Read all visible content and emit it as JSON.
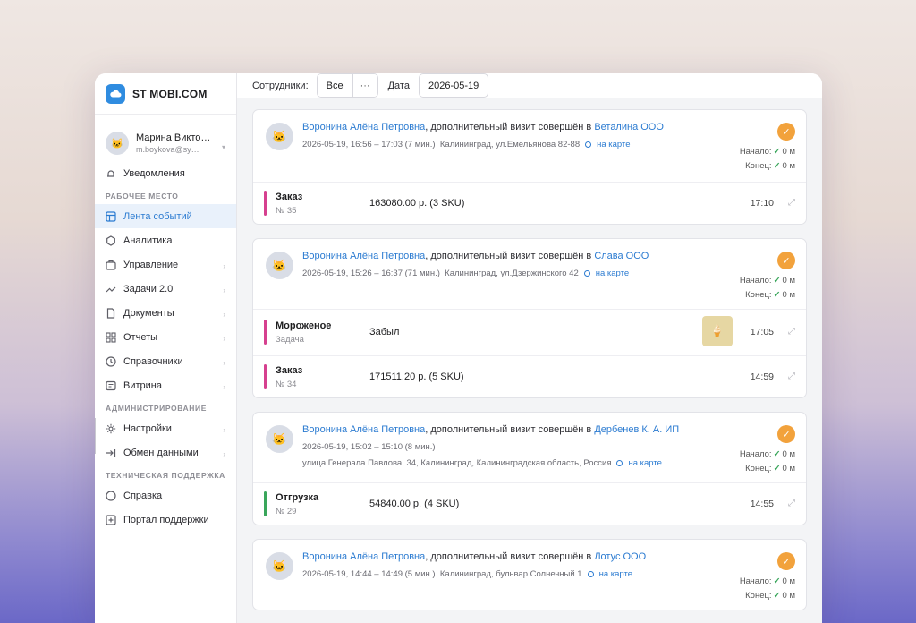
{
  "brand": {
    "name": "ST MOBI.COM",
    "icon": "cloud-icon"
  },
  "user": {
    "name": "Марина Викто…",
    "email": "m.boykova@sy…"
  },
  "nav": {
    "notifications": "Уведомления",
    "section_work": "РАБОЧЕЕ МЕСТО",
    "feed": "Лента событий",
    "analytics": "Аналитика",
    "management": "Управление",
    "tasks": "Задачи 2.0",
    "documents": "Документы",
    "reports": "Отчеты",
    "directories": "Справочники",
    "showcase": "Витрина",
    "section_admin": "АДМИНИСТРИРОВАНИЕ",
    "settings": "Настройки",
    "exchange": "Обмен данными",
    "section_support": "ТЕХНИЧЕСКАЯ ПОДДЕРЖКА",
    "help": "Справка",
    "portal": "Портал поддержки"
  },
  "toolbar": {
    "employees_label": "Сотрудники:",
    "employees_value": "Все",
    "more": "···",
    "date_label": "Дата",
    "date_value": "2026-05-19"
  },
  "labels": {
    "start": "Начало:",
    "end": "Конец:",
    "map": "на карте"
  },
  "colors": {
    "accent": "#2b7bd1",
    "status": "#f2a23c",
    "order": "#d6408f",
    "shipment": "#3aa65b"
  },
  "events": [
    {
      "person": "Воронина Алёна Петровна",
      "action": ", дополнительный визит совершён в ",
      "place": "Веталина ООО",
      "time": "2026-05-19, 16:56 – 17:03 (7 мин.)",
      "address": "Калининград, ул.Емельянова 82-88",
      "start": "0 м",
      "end": "0 м",
      "rows": [
        {
          "title": "Заказ",
          "sub": "№ 35",
          "value": "163080.00 р. (3 SKU)",
          "time": "17:10"
        }
      ]
    },
    {
      "person": "Воронина Алёна Петровна",
      "action": ", дополнительный визит совершён в ",
      "place": "Слава ООО",
      "time": "2026-05-19, 15:26 – 16:37 (71 мин.)",
      "address": "Калининград, ул.Дзержинского 42",
      "start": "0 м",
      "end": "0 м",
      "rows": [
        {
          "title": "Мороженое",
          "sub": "Задача",
          "value": "Забыл",
          "time": "17:05"
        },
        {
          "title": "Заказ",
          "sub": "№ 34",
          "value": "171511.20 р. (5 SKU)",
          "time": "14:59"
        }
      ]
    },
    {
      "person": "Воронина Алёна Петровна",
      "action": ", дополнительный визит совершён в ",
      "place": "Дербенев К. А. ИП",
      "time": "2026-05-19, 15:02 – 15:10 (8 мин.)",
      "address": "улица Генерала Павлова, 34, Калининград, Калининградская область, Россия",
      "start": "0 м",
      "end": "0 м",
      "rows": [
        {
          "title": "Отгрузка",
          "sub": "№ 29",
          "value": "54840.00 р. (4 SKU)",
          "time": "14:55"
        }
      ]
    },
    {
      "person": "Воронина Алёна Петровна",
      "action": ", дополнительный визит совершён в ",
      "place": "Лотус ООО",
      "time": "2026-05-19, 14:44 – 14:49 (5 мин.)",
      "address": "Калининград, бульвар Солнечный 1",
      "start": "0 м",
      "end": "0 м"
    }
  ]
}
